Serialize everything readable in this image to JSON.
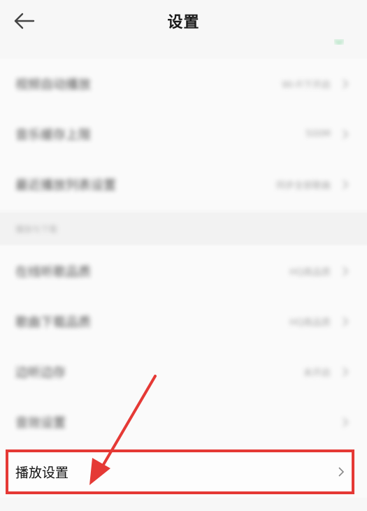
{
  "header": {
    "title": "设置",
    "back_icon": "back-arrow-icon"
  },
  "colors": {
    "accent_green": "#3cc46a",
    "annotation_red": "#e53935",
    "background": "#f7f7f7"
  },
  "group_1": {
    "rows": [
      {
        "label": "视频自动播放",
        "value": "Wi-Fi下开启"
      },
      {
        "label": "音乐缓存上限",
        "value": "500M"
      },
      {
        "label": "最近播放列表设置",
        "value": "同步全部歌曲"
      }
    ]
  },
  "section_2": {
    "header": "播放与下载",
    "rows": [
      {
        "label": "在线听歌品质",
        "value": "HQ高品质"
      },
      {
        "label": "歌曲下载品质",
        "value": "HQ高品质"
      },
      {
        "label": "边听边存",
        "value": "未开启"
      },
      {
        "label": "音效设置",
        "value": ""
      },
      {
        "label": "播放设置",
        "value": ""
      }
    ]
  }
}
